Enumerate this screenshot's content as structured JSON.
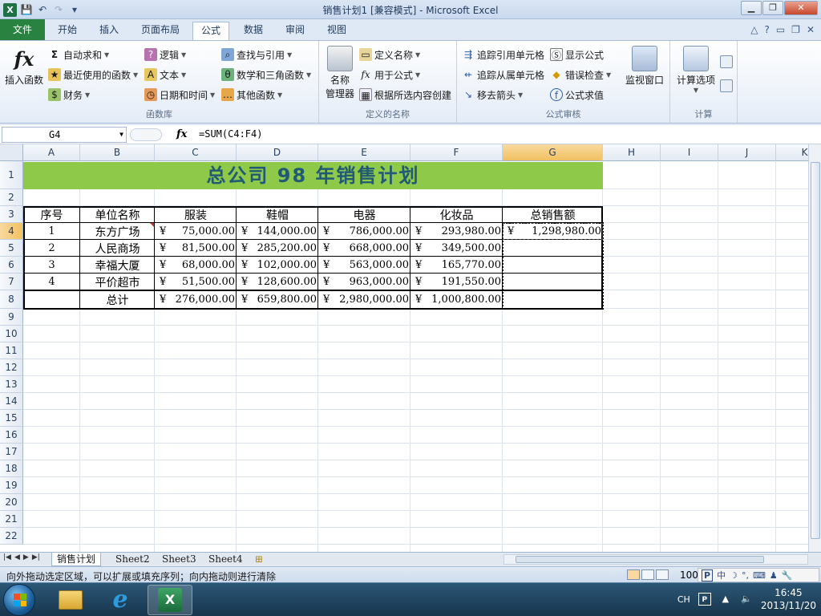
{
  "window": {
    "title": "销售计划1  [兼容模式]  -  Microsoft Excel",
    "minimize": "▁",
    "restore": "❐",
    "close": "✕",
    "qat_app": "X",
    "qat_save": "💾",
    "qat_undo": "↶",
    "qat_redo": "↷",
    "qat_customize": "▾"
  },
  "ribbon_tabs": {
    "file": "文件",
    "tabs": [
      "开始",
      "插入",
      "页面布局",
      "公式",
      "数据",
      "审阅",
      "视图"
    ],
    "active": "公式",
    "right_controls": [
      "△",
      "?",
      "▭",
      "❐",
      "✕"
    ]
  },
  "ribbon": {
    "function_library": {
      "label": "函数库",
      "insert_function": "插入函数",
      "insert_function_glyph": "fx",
      "autosum": "自动求和",
      "recent": "最近使用的函数",
      "financial": "财务",
      "logical": "逻辑",
      "text": "文本",
      "datetime": "日期和时间",
      "lookup": "查找与引用",
      "math": "数学和三角函数",
      "more": "其他函数"
    },
    "defined_names": {
      "label": "定义的名称",
      "name_manager": "名称\n管理器",
      "define_name": "定义名称",
      "use_in_formula": "用于公式",
      "create_from_selection": "根据所选内容创建"
    },
    "formula_auditing": {
      "label": "公式审核",
      "trace_precedents": "追踪引用单元格",
      "trace_dependents": "追踪从属单元格",
      "remove_arrows": "移去箭头",
      "show_formulas": "显示公式",
      "error_checking": "错误检查",
      "evaluate_formula": "公式求值",
      "watch_window": "监视窗口"
    },
    "calculation": {
      "label": "计算",
      "calc_options": "计算选项"
    }
  },
  "formula_bar": {
    "name_box": "G4",
    "fx": "fx",
    "formula": "=SUM(C4:F4)"
  },
  "grid": {
    "columns": [
      "A",
      "B",
      "C",
      "D",
      "E",
      "F",
      "G",
      "H",
      "I",
      "J",
      "K"
    ],
    "rows": [
      "1",
      "2",
      "3",
      "4",
      "5",
      "6",
      "7",
      "8",
      "9",
      "10",
      "11",
      "12",
      "13",
      "14",
      "15",
      "16",
      "17",
      "18",
      "19",
      "20",
      "21",
      "22"
    ],
    "selected_column": "G",
    "selected_row": "4"
  },
  "sheet": {
    "title": "总公司  98  年销售计划",
    "headers": [
      "序号",
      "单位名称",
      "服装",
      "鞋帽",
      "电器",
      "化妆品",
      "总销售额"
    ],
    "currency_symbol": "¥",
    "rows": [
      {
        "no": "1",
        "unit": "东方广场",
        "clothing": "75,000.00",
        "shoes": "144,000.00",
        "electrical": "786,000.00",
        "cosmetics": "293,980.00",
        "total": "1,298,980.00"
      },
      {
        "no": "2",
        "unit": "人民商场",
        "clothing": "81,500.00",
        "shoes": "285,200.00",
        "electrical": "668,000.00",
        "cosmetics": "349,500.00",
        "total": ""
      },
      {
        "no": "3",
        "unit": "幸福大厦",
        "clothing": "68,000.00",
        "shoes": "102,000.00",
        "electrical": "563,000.00",
        "cosmetics": "165,770.00",
        "total": ""
      },
      {
        "no": "4",
        "unit": "平价超市",
        "clothing": "51,500.00",
        "shoes": "128,600.00",
        "electrical": "963,000.00",
        "cosmetics": "191,550.00",
        "total": ""
      }
    ],
    "total_row": {
      "label": "总计",
      "clothing": "276,000.00",
      "shoes": "659,800.00",
      "electrical": "2,980,000.00",
      "cosmetics": "1,000,800.00"
    }
  },
  "sheet_tabs": {
    "tabs": [
      "销售计划",
      "Sheet2",
      "Sheet3",
      "Sheet4"
    ],
    "active": "销售计划"
  },
  "status_bar": {
    "message": "向外拖动选定区域，可以扩展或填充序列；向内拖动则进行清除",
    "zoom": "100",
    "ime_items": [
      "中",
      "☽",
      "°,",
      "⌨",
      "♟",
      "🔧"
    ]
  },
  "taskbar": {
    "lang": "CH",
    "time": "16:45",
    "date": "2013/11/20",
    "ie_glyph": "e",
    "excel_glyph": "X"
  },
  "colors": {
    "title_fill": "#8fc94a",
    "title_text": "#215a75",
    "file_tab": "#2a8241",
    "selected_header": "#f1c15f"
  }
}
